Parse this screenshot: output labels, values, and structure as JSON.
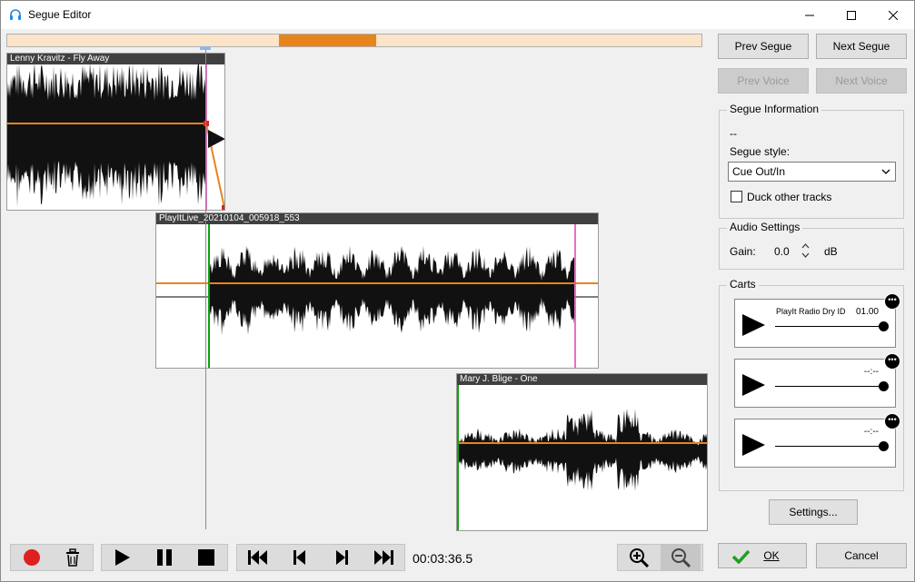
{
  "window": {
    "title": "Segue Editor"
  },
  "tracks": [
    {
      "title": "Lenny Kravitz - Fly Away"
    },
    {
      "title": "PlayItLive_20210104_005918_553"
    },
    {
      "title": "Mary J. Blige - One"
    }
  ],
  "nav": {
    "prev_segue": "Prev Segue",
    "next_segue": "Next Segue",
    "prev_voice": "Prev Voice",
    "next_voice": "Next Voice"
  },
  "segue_info": {
    "group_label": "Segue Information",
    "value": "--",
    "style_label": "Segue style:",
    "style_value": "Cue Out/In",
    "duck_label": "Duck other tracks",
    "duck_checked": false
  },
  "audio": {
    "group_label": "Audio Settings",
    "gain_label": "Gain:",
    "gain_value": "0.0",
    "gain_unit": "dB"
  },
  "carts": {
    "group_label": "Carts",
    "items": [
      {
        "name": "PlayIt Radio Dry ID",
        "time": "01.00"
      },
      {
        "name": "",
        "time": "--:--"
      },
      {
        "name": "",
        "time": "--:--"
      }
    ]
  },
  "settings_label": "Settings...",
  "ok_label": "OK",
  "cancel_label": "Cancel",
  "transport": {
    "time": "00:03:36.5"
  },
  "colors": {
    "accent": "#e8841c",
    "cue_out": "#e040b0",
    "cue_in": "#10a010",
    "record": "#e02020"
  }
}
